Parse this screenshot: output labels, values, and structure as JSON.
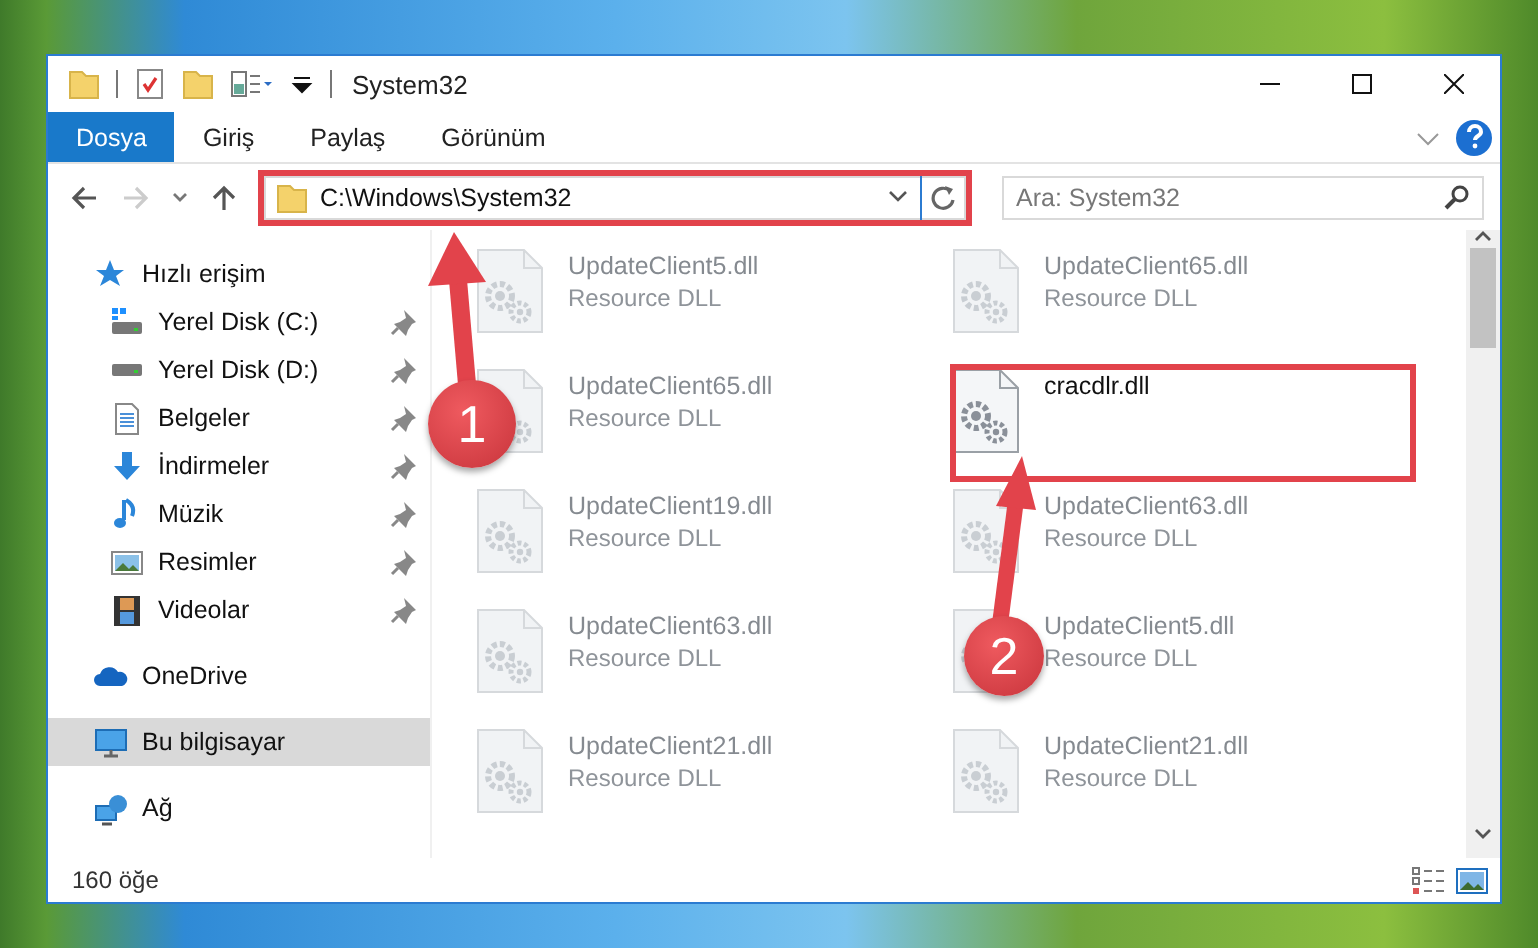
{
  "window": {
    "title": "System32"
  },
  "ribbon_tabs": [
    {
      "label": "Dosya",
      "selected": true
    },
    {
      "label": "Giriş",
      "selected": false
    },
    {
      "label": "Paylaş",
      "selected": false
    },
    {
      "label": "Görünüm",
      "selected": false
    }
  ],
  "address_bar": {
    "value": "C:\\Windows\\System32",
    "highlighted": true
  },
  "search": {
    "placeholder": "Ara: System32"
  },
  "sidebar": {
    "items": [
      {
        "label": "Hızlı erişim",
        "kind": "quick-access",
        "selected": false,
        "children": [
          {
            "label": "Yerel Disk (C:)",
            "kind": "drive-system",
            "pinned": true,
            "selected": false
          },
          {
            "label": "Yerel Disk (D:)",
            "kind": "drive",
            "pinned": true,
            "selected": false
          },
          {
            "label": "Belgeler",
            "kind": "documents",
            "pinned": true,
            "selected": false
          },
          {
            "label": "İndirmeler",
            "kind": "downloads",
            "pinned": true,
            "selected": false
          },
          {
            "label": "Müzik",
            "kind": "music",
            "pinned": true,
            "selected": false
          },
          {
            "label": "Resimler",
            "kind": "pictures",
            "pinned": true,
            "selected": false
          },
          {
            "label": "Videolar",
            "kind": "videos",
            "pinned": true,
            "selected": false
          }
        ]
      },
      {
        "label": "OneDrive",
        "kind": "cloud",
        "selected": false
      },
      {
        "label": "Bu bilgisayar",
        "kind": "computer",
        "selected": true
      },
      {
        "label": "Ağ",
        "kind": "network",
        "selected": false
      }
    ]
  },
  "files": [
    {
      "name": "UpdateClient5.dll",
      "type": "Resource DLL",
      "blurred": true
    },
    {
      "name": "UpdateClient65.dll",
      "type": "Resource DLL",
      "blurred": true
    },
    {
      "name": "UpdateClient65.dll",
      "type": "Resource DLL",
      "blurred": true
    },
    {
      "name": "cracdlr.dll",
      "blurred": false
    },
    {
      "name": "UpdateClient19.dll",
      "type": "Resource DLL",
      "blurred": true
    },
    {
      "name": "UpdateClient63.dll",
      "type": "Resource DLL",
      "blurred": true
    },
    {
      "name": "UpdateClient63.dll",
      "type": "Resource DLL",
      "blurred": true
    },
    {
      "name": "UpdateClient5.dll",
      "type": "Resource DLL",
      "blurred": true
    },
    {
      "name": "UpdateClient21.dll",
      "type": "Resource DLL",
      "blurred": true
    },
    {
      "name": "UpdateClient21.dll",
      "type": "Resource DLL",
      "blurred": true
    }
  ],
  "status_bar": {
    "item_count": "160 öğe"
  },
  "callouts": [
    {
      "number": "1"
    },
    {
      "number": "2"
    }
  ]
}
